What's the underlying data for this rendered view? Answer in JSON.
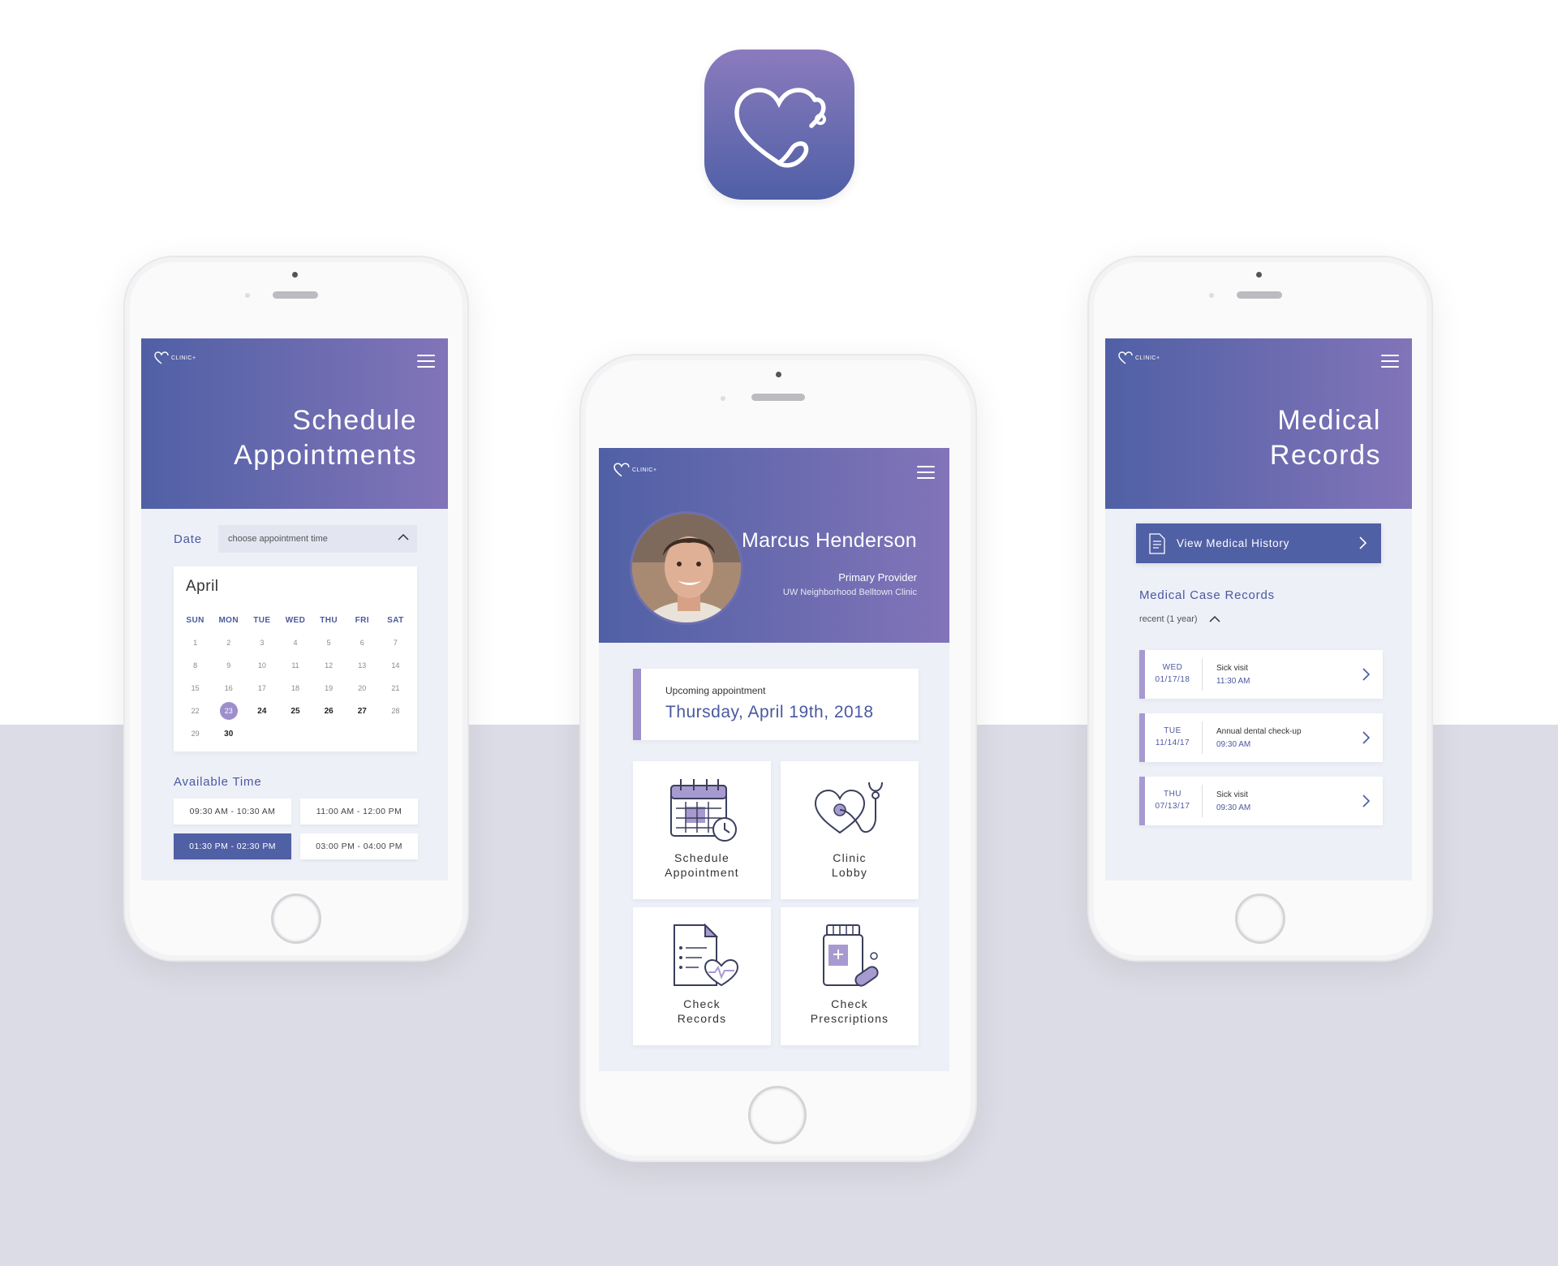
{
  "brand": {
    "logo_text": "CLINIC+",
    "accent": "#5060a5",
    "accent_light": "#8274b9",
    "highlight": "#9d8fcb"
  },
  "schedule_screen": {
    "title_line1": "Schedule",
    "title_line2": "Appointments",
    "date_label": "Date",
    "date_placeholder": "choose appointment time",
    "month": "April",
    "weekdays": [
      "SUN",
      "MON",
      "TUE",
      "WED",
      "THU",
      "FRI",
      "SAT"
    ],
    "weeks": [
      [
        "1",
        "2",
        "3",
        "4",
        "5",
        "6",
        "7"
      ],
      [
        "8",
        "9",
        "10",
        "11",
        "12",
        "13",
        "14"
      ],
      [
        "15",
        "16",
        "17",
        "18",
        "19",
        "20",
        "21"
      ],
      [
        "22",
        "23",
        "24",
        "25",
        "26",
        "27",
        "28"
      ],
      [
        "29",
        "30",
        "",
        "",
        "",
        "",
        ""
      ]
    ],
    "selected_day": "23",
    "available_time_label": "Available Time",
    "slots": [
      "09:30 AM - 10:30 AM",
      "11:00 AM - 12:00 PM",
      "01:30 PM - 02:30 PM",
      "03:00 PM - 04:00 PM"
    ],
    "active_slot": "01:30 PM - 02:30 PM"
  },
  "home_screen": {
    "user_name": "Marcus Henderson",
    "role": "Primary Provider",
    "clinic": "UW Neighborhood Belltown Clinic",
    "upcoming_label": "Upcoming appointment",
    "upcoming_date": "Thursday, April 19th, 2018",
    "tiles": [
      {
        "line1": "Schedule",
        "line2": "Appointment",
        "icon": "calendar-clock-icon"
      },
      {
        "line1": "Clinic",
        "line2": "Lobby",
        "icon": "heart-stethoscope-icon"
      },
      {
        "line1": "Check",
        "line2": "Records",
        "icon": "document-heart-icon"
      },
      {
        "line1": "Check",
        "line2": "Prescriptions",
        "icon": "pill-bottle-icon"
      }
    ]
  },
  "records_screen": {
    "title_line1": "Medical",
    "title_line2": "Records",
    "history_button": "View Medical History",
    "case_records_label": "Medical Case Records",
    "filter": "recent (1 year)",
    "records": [
      {
        "day": "WED",
        "date": "01/17/18",
        "desc": "Sick visit",
        "time": "11:30 AM"
      },
      {
        "day": "TUE",
        "date": "11/14/17",
        "desc": "Annual dental check-up",
        "time": "09:30 AM"
      },
      {
        "day": "THU",
        "date": "07/13/17",
        "desc": "Sick visit",
        "time": "09:30 AM"
      }
    ]
  }
}
